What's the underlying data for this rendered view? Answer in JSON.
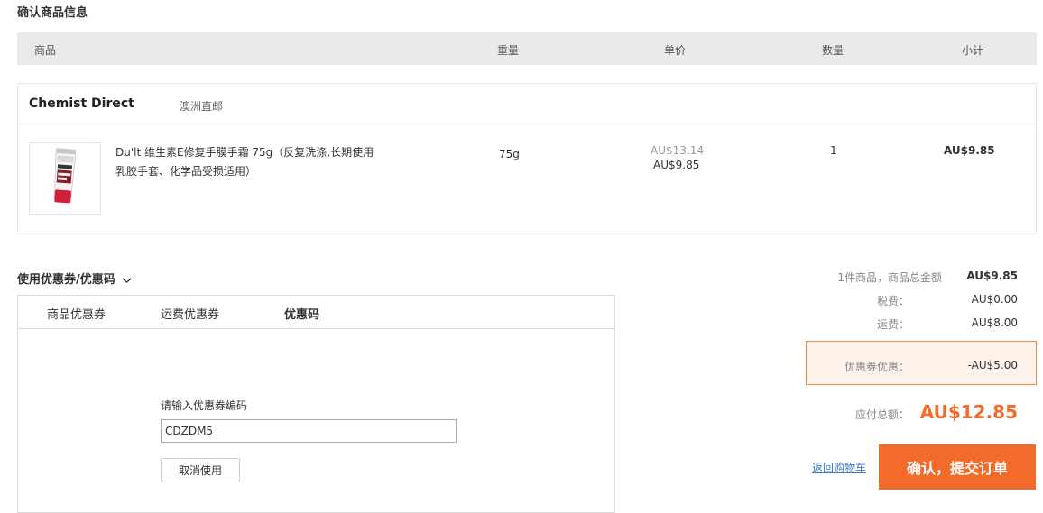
{
  "page": {
    "title": "确认商品信息"
  },
  "table_header": {
    "product": "商品",
    "weight": "重量",
    "unit_price": "单价",
    "quantity": "数量",
    "subtotal": "小计"
  },
  "store": {
    "name": "Chemist Direct",
    "tag": "澳洲直邮",
    "items": [
      {
        "name_line1": "Du'lt 维生素E修复手膜手霜 75g（反复洗涤,长期使用",
        "name_line2": "乳胶手套、化学品受损适用）",
        "weight": "75g",
        "original_price": "AU$13.14",
        "price": "AU$9.85",
        "quantity": "1",
        "subtotal": "AU$9.85"
      }
    ]
  },
  "coupon": {
    "toggle_label": "使用优惠券/优惠码",
    "tabs": [
      "商品优惠券",
      "运费优惠券",
      "优惠码"
    ],
    "active_tab": "优惠码",
    "code_label": "请输入优惠券编码",
    "code_value": "CDZDM5",
    "cancel_label": "取消使用"
  },
  "summary": {
    "items_label": "1件商品，商品总金额",
    "items_value": "AU$9.85",
    "tax_label": "税费：",
    "tax_value": "AU$0.00",
    "shipping_label": "运费：",
    "shipping_value": "AU$8.00",
    "discount_label": "优惠券优惠：",
    "discount_value": "-AU$5.00",
    "total_label": "应付总额：",
    "total_value": "AU$12.85"
  },
  "actions": {
    "back_label": "返回购物车",
    "submit_label": "确认，提交订单"
  },
  "colors": {
    "accent": "#f26b2a",
    "link": "#3a7ac8",
    "discount_bg": "#fdf2e9"
  },
  "icons": {
    "toggle": "chevron-down-icon"
  }
}
